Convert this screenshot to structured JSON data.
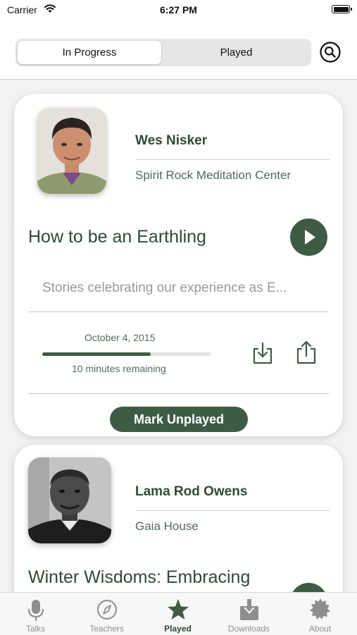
{
  "status_bar": {
    "carrier": "Carrier",
    "time": "6:27 PM"
  },
  "segments": {
    "in_progress": "In Progress",
    "played": "Played",
    "selected": "In Progress"
  },
  "talks": [
    {
      "teacher": "Wes Nisker",
      "center": "Spirit Rock Meditation Center",
      "title": "How to be an Earthling",
      "description": "Stories celebrating our experience as E...",
      "date": "October 4, 2015",
      "progress_fraction": 0.64,
      "remaining": "10 minutes remaining",
      "mark_button": "Mark Unplayed"
    },
    {
      "teacher": "Lama Rod Owens",
      "center": "Gaia House",
      "title": "Winter Wisdoms: Embracing"
    }
  ],
  "tabs": [
    {
      "label": "Talks",
      "icon": "microphone-icon"
    },
    {
      "label": "Teachers",
      "icon": "compass-icon"
    },
    {
      "label": "Played",
      "icon": "star-icon"
    },
    {
      "label": "Downloads",
      "icon": "download-tray-icon"
    },
    {
      "label": "About",
      "icon": "sun-badge-icon"
    }
  ],
  "active_tab": "Played",
  "colors": {
    "accent": "#3e5c45",
    "text": "#2f4a36",
    "inactive": "#8e8e8e"
  }
}
